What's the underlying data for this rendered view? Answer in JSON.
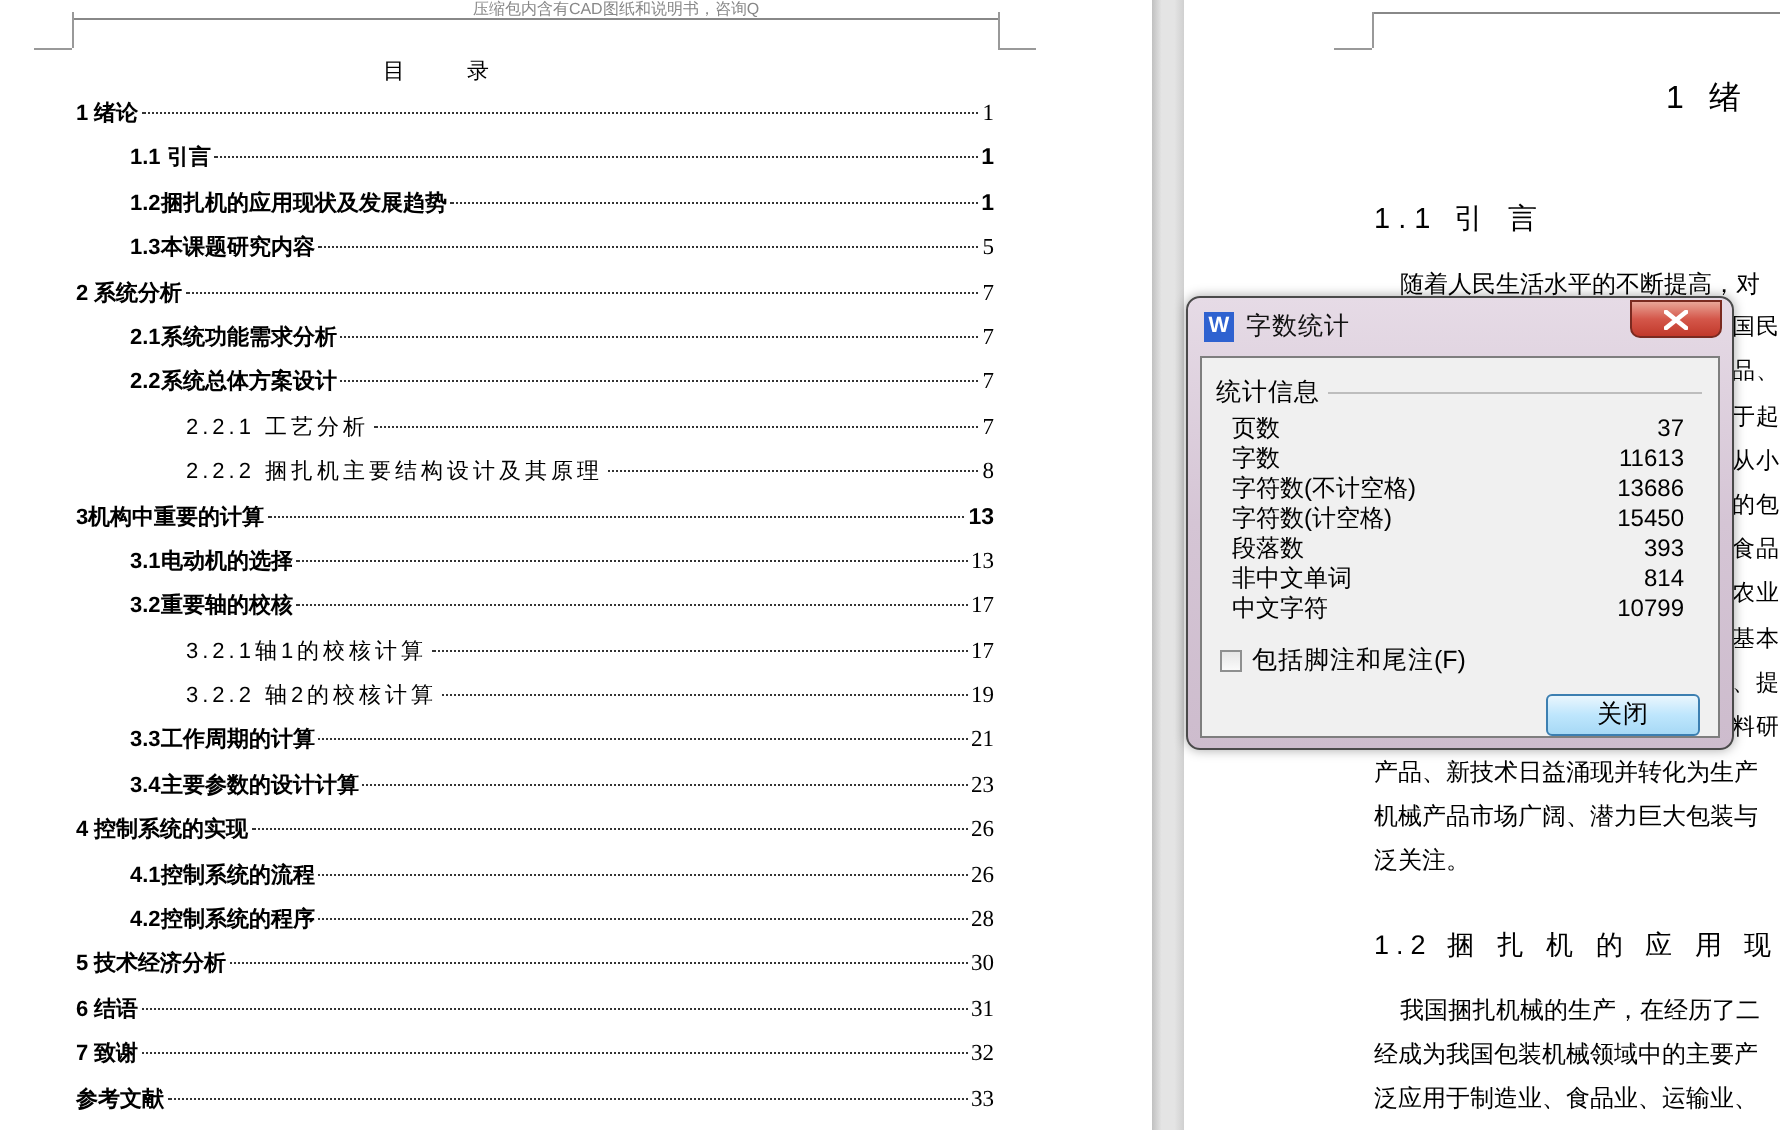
{
  "left_page": {
    "header": "压缩包内含有CAD图纸和说明书，咨询Q",
    "title": "目 录",
    "toc": [
      {
        "title": "1 绪论",
        "page": "1",
        "page_bold": false,
        "children": [
          {
            "title": "1.1 引言",
            "page": "1",
            "page_bold": true
          },
          {
            "title": "1.2捆扎机的应用现状及发展趋势",
            "page": "1",
            "page_bold": true
          },
          {
            "title": "1.3本课题研究内容",
            "page": "5",
            "page_bold": false
          }
        ]
      },
      {
        "title": "2 系统分析",
        "page": "7",
        "page_bold": false,
        "children": [
          {
            "title": "2.1系统功能需求分析",
            "page": "7",
            "page_bold": false
          },
          {
            "title": "2.2系统总体方案设计",
            "page": "7",
            "page_bold": false,
            "children": [
              {
                "title": "2.2.1 工艺分析",
                "page": "7",
                "page_bold": false
              },
              {
                "title": "2.2.2 捆扎机主要结构设计及其原理",
                "page": "8",
                "page_bold": false
              }
            ]
          }
        ]
      },
      {
        "title": "3机构中重要的计算",
        "page": "13",
        "page_bold": true,
        "children": [
          {
            "title": "3.1电动机的选择",
            "page": "13",
            "page_bold": false
          },
          {
            "title": "3.2重要轴的校核",
            "page": "17",
            "page_bold": false,
            "children": [
              {
                "title": "3.2.1轴1的校核计算",
                "page": "17",
                "page_bold": false
              },
              {
                "title": "3.2.2 轴2的校核计算",
                "page": "19",
                "page_bold": false
              }
            ]
          },
          {
            "title": "3.3工作周期的计算",
            "page": "21",
            "page_bold": false
          },
          {
            "title": "3.4主要参数的设计计算",
            "page": "23",
            "page_bold": false
          }
        ]
      },
      {
        "title": "4 控制系统的实现",
        "page": "26",
        "page_bold": false,
        "children": [
          {
            "title": "4.1控制系统的流程",
            "page": "26",
            "page_bold": false
          },
          {
            "title": "4.2控制系统的程序",
            "page": "28",
            "page_bold": false
          }
        ]
      },
      {
        "title": "5 技术经济分析",
        "page": "30",
        "page_bold": false
      },
      {
        "title": "6 结语",
        "page": "31",
        "page_bold": false
      },
      {
        "title": "7 致谢",
        "page": "32",
        "page_bold": false
      },
      {
        "title": "参考文献",
        "page": "33",
        "page_bold": false
      }
    ]
  },
  "right_page": {
    "chapter_title": "1 绪",
    "sections": [
      {
        "heading": "1.1 引 言",
        "lines": [
          {
            "kind": "indent",
            "text": "随着人民生活水平的不断提高，对"
          },
          {
            "kind": "fragment",
            "text": "国民"
          },
          {
            "kind": "fragment",
            "text": "品、"
          },
          {
            "kind": "fragment",
            "text": "于起"
          },
          {
            "kind": "fragment",
            "text": "从小"
          },
          {
            "kind": "fragment",
            "text": "的包"
          },
          {
            "kind": "fragment",
            "text": "食品"
          },
          {
            "kind": "fragment",
            "text": "农业"
          },
          {
            "kind": "fragment",
            "text": "基本"
          },
          {
            "kind": "fragment",
            "text": "、提"
          },
          {
            "kind": "fragment",
            "text": "料研"
          },
          {
            "kind": "line",
            "text": "产品、新技术日益涌现并转化为生产"
          },
          {
            "kind": "line",
            "text": "机械产品市场广阔、潜力巨大包装与"
          },
          {
            "kind": "line",
            "text": "泛关注。"
          }
        ]
      },
      {
        "heading": "1.2 捆 扎 机 的 应 用 现",
        "lines": [
          {
            "kind": "indent",
            "text": "我国捆扎机械的生产，在经历了二"
          },
          {
            "kind": "line",
            "text": "经成为我国包装机械领域中的主要产"
          },
          {
            "kind": "line",
            "text": "泛应用于制造业、食品业、运输业、"
          }
        ]
      }
    ]
  },
  "dialog": {
    "icon_letter": "W",
    "title": "字数统计",
    "group": "统计信息",
    "stats": [
      {
        "label": "页数",
        "value": "37"
      },
      {
        "label": "字数",
        "value": "11613"
      },
      {
        "label": "字符数(不计空格)",
        "value": "13686"
      },
      {
        "label": "字符数(计空格)",
        "value": "15450"
      },
      {
        "label": "段落数",
        "value": "393"
      },
      {
        "label": "非中文单词",
        "value": "814"
      },
      {
        "label": "中文字符",
        "value": "10799"
      }
    ],
    "checkbox": {
      "label": "包括脚注和尾注(F)",
      "checked": false
    },
    "button": "关闭"
  }
}
